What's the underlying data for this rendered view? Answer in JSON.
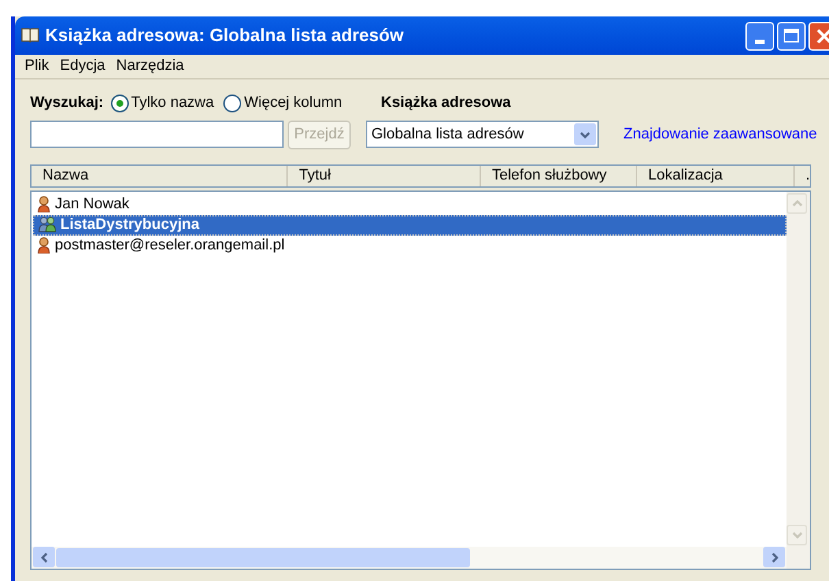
{
  "window": {
    "title": "Książka adresowa: Globalna lista adresów"
  },
  "menu": [
    "Plik",
    "Edycja",
    "Narzędzia"
  ],
  "search": {
    "label": "Wyszukaj:",
    "options": [
      {
        "label": "Tylko nazwa",
        "selected": true
      },
      {
        "label": "Więcej kolumn",
        "selected": false
      }
    ],
    "go_button": {
      "label": "Przejdź",
      "disabled": true
    }
  },
  "address_book": {
    "label": "Książka adresowa",
    "value": "Globalna lista adresów"
  },
  "advanced_link": "Znajdowanie zaawansowane",
  "table": {
    "columns": [
      "Nazwa",
      "Tytuł",
      "Telefon służbowy",
      "Lokalizacja",
      "."
    ],
    "rows": [
      {
        "kind": "person",
        "name": "Jan Nowak",
        "selected": false
      },
      {
        "kind": "group",
        "name": "ListaDystrybucyjna",
        "selected": true
      },
      {
        "kind": "person",
        "name": "postmaster@reseler.orangemail.pl",
        "selected": false
      }
    ]
  }
}
